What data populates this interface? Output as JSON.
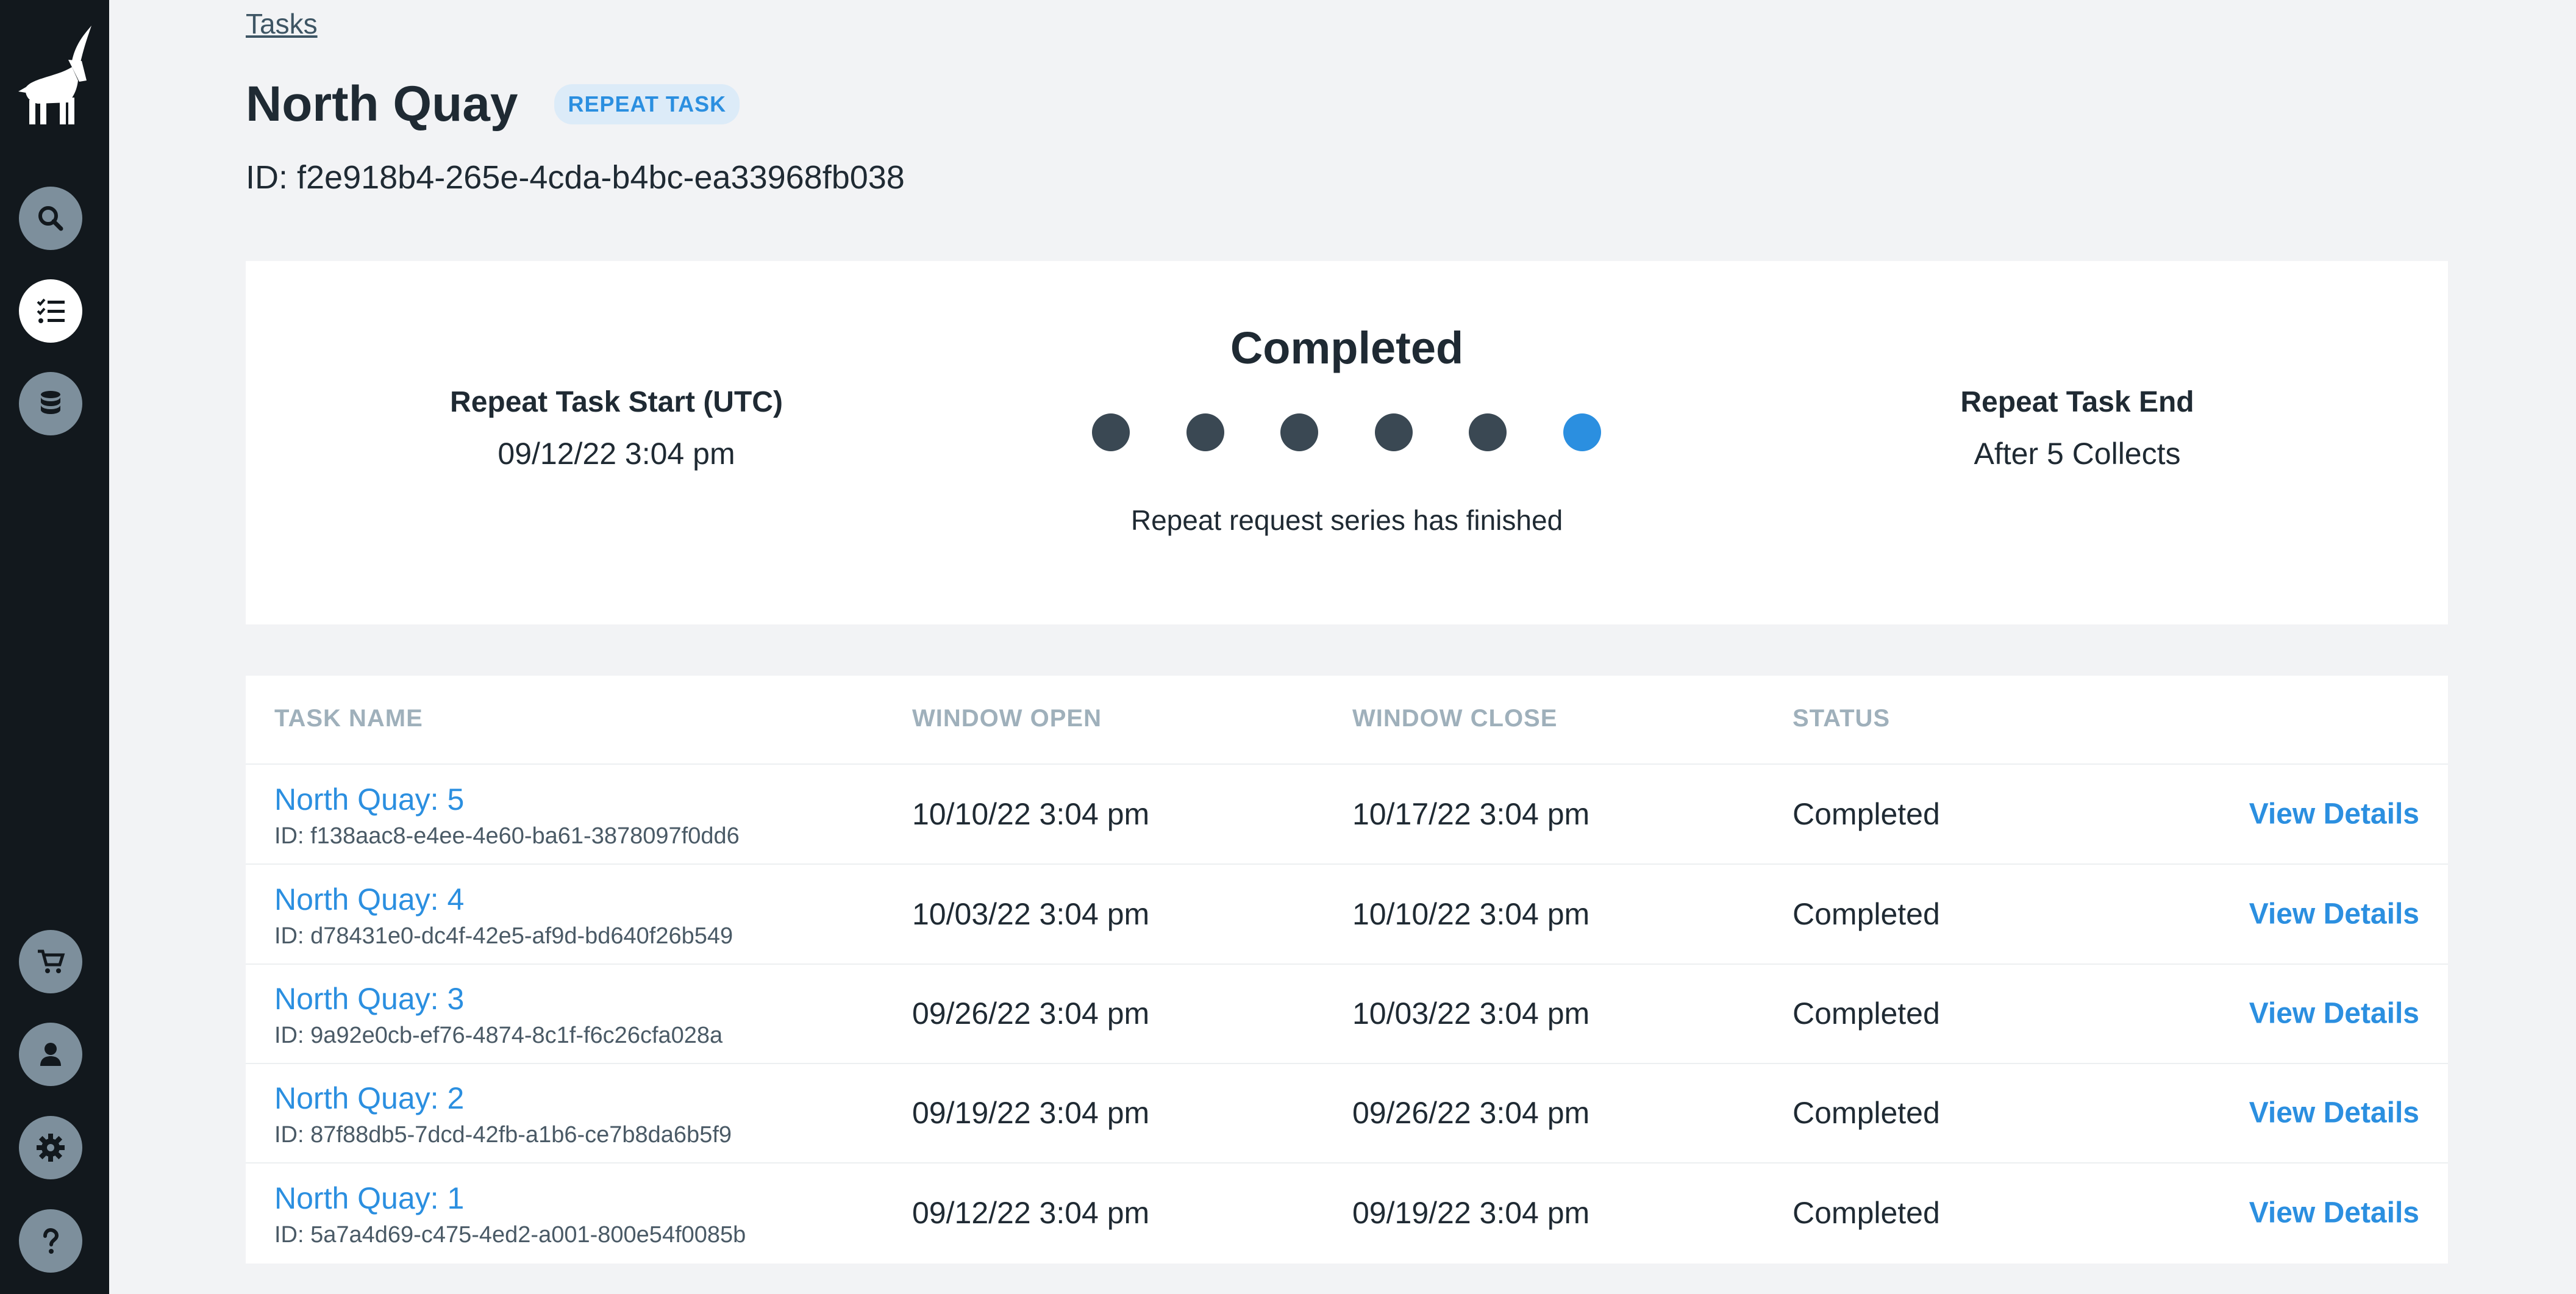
{
  "breadcrumb": "Tasks",
  "header": {
    "title": "North Quay",
    "badge": "REPEAT TASK",
    "id_text": "ID: f2e918b4-265e-4cda-b4bc-ea33968fb038"
  },
  "sidebar": {
    "top_items": [
      {
        "icon": "search-icon"
      },
      {
        "icon": "task-list-icon",
        "active": true
      },
      {
        "icon": "database-icon"
      }
    ],
    "bottom_items": [
      {
        "icon": "cart-icon"
      },
      {
        "icon": "user-icon"
      },
      {
        "icon": "gear-icon"
      },
      {
        "icon": "help-icon"
      }
    ]
  },
  "status_card": {
    "start_label": "Repeat Task Start (UTC)",
    "start_value": "09/12/22 3:04 pm",
    "status": "Completed",
    "description": "Repeat request series has finished",
    "end_label": "Repeat Task End",
    "end_value": "After 5 Collects",
    "progress_dots": 6,
    "current_dot": 6
  },
  "table": {
    "headers": [
      "TASK NAME",
      "WINDOW OPEN",
      "WINDOW CLOSE",
      "STATUS"
    ],
    "rows": [
      {
        "name": "North Quay: 5",
        "id": "ID: f138aac8-e4ee-4e60-ba61-3878097f0dd6",
        "open": "10/10/22 3:04 pm",
        "close": "10/17/22 3:04 pm",
        "status": "Completed",
        "action": "View Details"
      },
      {
        "name": "North Quay: 4",
        "id": "ID: d78431e0-dc4f-42e5-af9d-bd640f26b549",
        "open": "10/03/22 3:04 pm",
        "close": "10/10/22 3:04 pm",
        "status": "Completed",
        "action": "View Details"
      },
      {
        "name": "North Quay: 3",
        "id": "ID: 9a92e0cb-ef76-4874-8c1f-f6c26cfa028a",
        "open": "09/26/22 3:04 pm",
        "close": "10/03/22 3:04 pm",
        "status": "Completed",
        "action": "View Details"
      },
      {
        "name": "North Quay: 2",
        "id": "ID: 87f88db5-7dcd-42fb-a1b6-ce7b8da6b5f9",
        "open": "09/19/22 3:04 pm",
        "close": "09/26/22 3:04 pm",
        "status": "Completed",
        "action": "View Details"
      },
      {
        "name": "North Quay: 1",
        "id": "ID: 5a7a4d69-c475-4ed2-a001-800e54f0085b",
        "open": "09/12/22 3:04 pm",
        "close": "09/19/22 3:04 pm",
        "status": "Completed",
        "action": "View Details"
      }
    ]
  },
  "colors": {
    "sidebar_bg": "#12181d",
    "accent": "#2b8fe0",
    "page_bg": "#f2f3f5",
    "dot_done": "#3a4853"
  }
}
